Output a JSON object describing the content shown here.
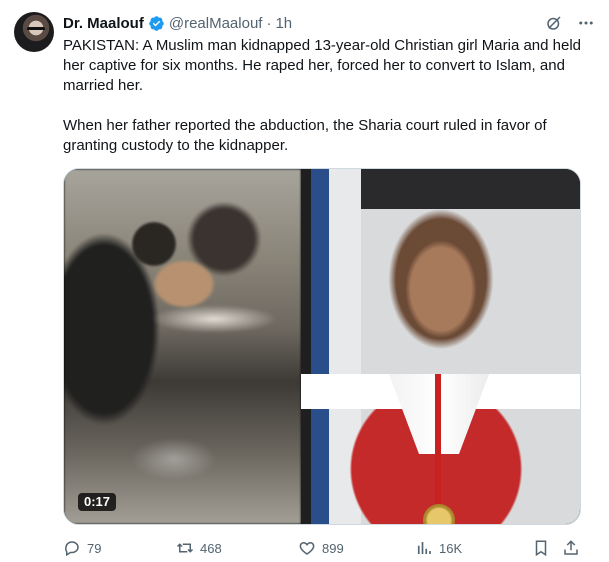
{
  "author": {
    "display_name": "Dr. Maalouf",
    "handle": "@realMaalouf",
    "time": "1h",
    "verified_color": "#1d9bf0"
  },
  "tweet": {
    "paragraph_1": "PAKISTAN: A Muslim man kidnapped 13-year-old Christian girl Maria and held her captive for six months. He raped her, forced her to convert to Islam, and married her.",
    "paragraph_2": "When her father reported the abduction, the Sharia court ruled in favor of granting custody to the kidnapper."
  },
  "media": {
    "duration": "0:17"
  },
  "actions": {
    "replies": "79",
    "reposts": "468",
    "likes": "899",
    "views": "16K"
  },
  "icons": {
    "header": [
      "grok-icon",
      "more-icon"
    ],
    "actions": [
      "reply-icon",
      "repost-icon",
      "like-icon",
      "views-icon",
      "bookmark-icon",
      "share-icon"
    ]
  },
  "colors": {
    "text_primary": "#0f1419",
    "text_secondary": "#536471",
    "accent": "#1d9bf0"
  }
}
